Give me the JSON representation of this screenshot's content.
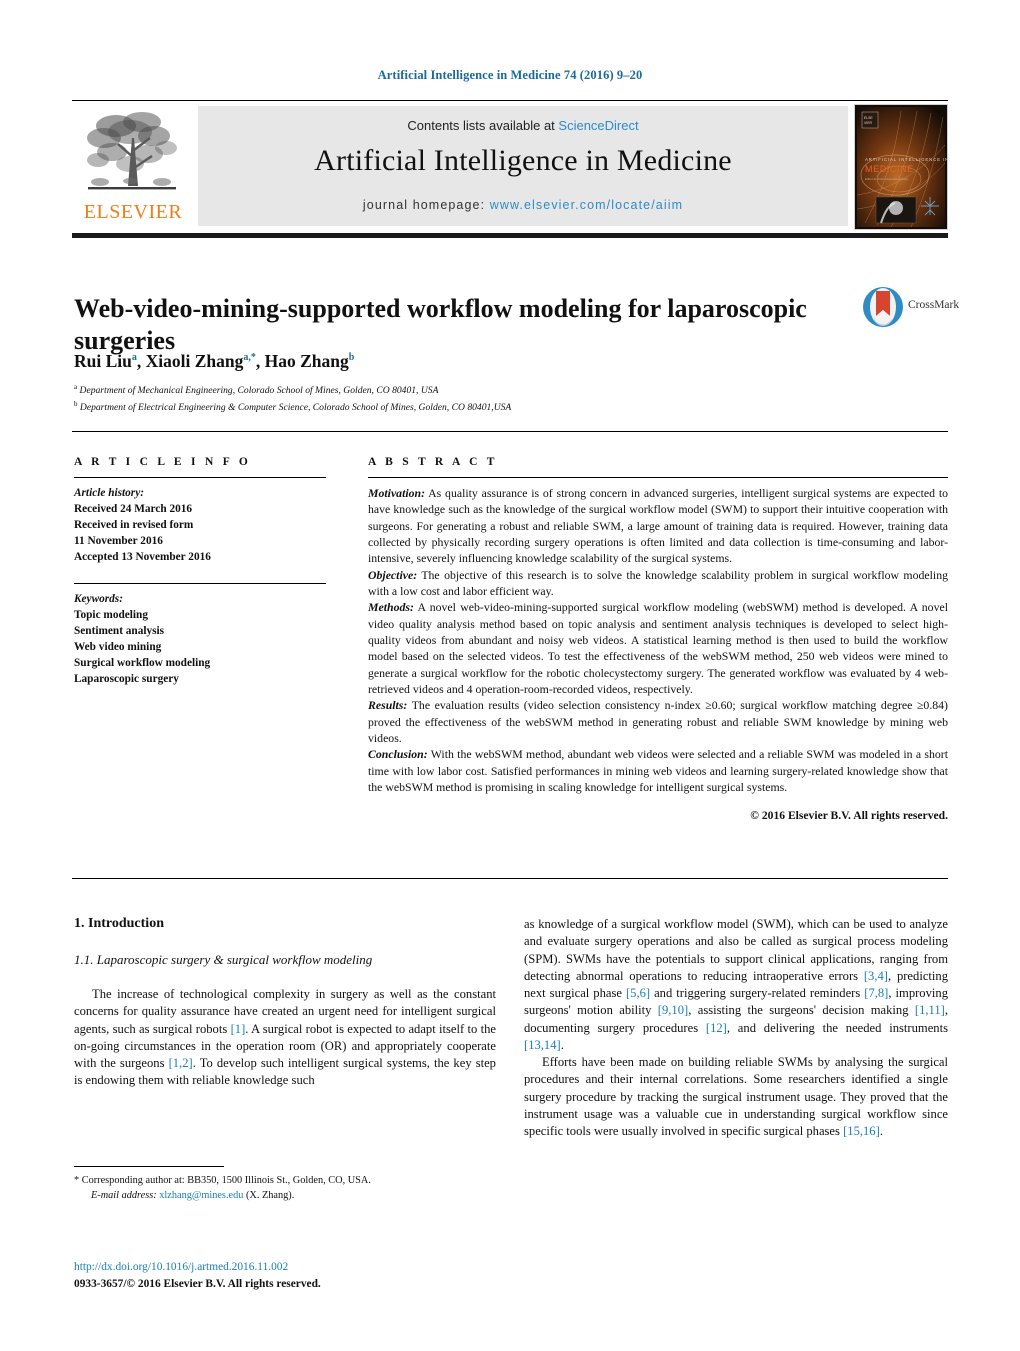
{
  "running_head": "Artificial Intelligence in Medicine 74 (2016) 9–20",
  "masthead": {
    "contents_prefix": "Contents lists available at ",
    "sciencedirect": "ScienceDirect",
    "journal_title": "Artificial Intelligence in Medicine",
    "homepage_prefix": "journal homepage: ",
    "homepage_url": "www.elsevier.com/locate/aiim",
    "publisher_wordmark": "ELSEVIER",
    "publisher_logo_icon": "elsevier-tree-icon",
    "cover_thumbnail_icon": "journal-cover-thumbnail",
    "cover_title_line1": "ARTIFICIAL INTELLIGENCE IN",
    "cover_title_line2": "MEDICINE",
    "link_color": "#2e8bc9"
  },
  "article": {
    "title": "Web-video-mining-supported workflow modeling for laparoscopic surgeries",
    "crossmark_label": "CrossMark",
    "crossmark_icon": "crossmark-badge-icon",
    "authors_html": "Rui Liu<sup>a</sup>, Xiaoli Zhang<sup>a,*</sup>, Hao Zhang<sup>b</sup>",
    "affiliation_a": "Department of Mechanical Engineering, Colorado School of Mines, Golden, CO 80401, USA",
    "affiliation_b": "Department of Electrical Engineering & Computer Science, Colorado School of Mines, Golden, CO 80401,USA"
  },
  "article_info": {
    "heading": "A R T I C L E    I N F O",
    "history_label": "Article history:",
    "history_lines": [
      "Received 24 March 2016",
      "Received in revised form",
      "11 November 2016",
      "Accepted 13 November 2016"
    ],
    "keywords_label": "Keywords:",
    "keywords": [
      "Topic modeling",
      "Sentiment analysis",
      "Web video mining",
      "Surgical workflow modeling",
      "Laparoscopic surgery"
    ]
  },
  "abstract": {
    "heading": "A B S T R A C T",
    "paragraphs": [
      {
        "lead": "Motivation:",
        "text": " As quality assurance is of strong concern in advanced surgeries, intelligent surgical systems are expected to have knowledge such as the knowledge of the surgical workflow model (SWM) to support their intuitive cooperation with surgeons. For generating a robust and reliable SWM, a large amount of training data is required. However, training data collected by physically recording surgery operations is often limited and data collection is time-consuming and labor-intensive, severely influencing knowledge scalability of the surgical systems."
      },
      {
        "lead": "Objective:",
        "text": " The objective of this research is to solve the knowledge scalability problem in surgical workflow modeling with a low cost and labor efficient way."
      },
      {
        "lead": "Methods:",
        "text": " A novel web-video-mining-supported surgical workflow modeling (webSWM) method is developed. A novel video quality analysis method based on topic analysis and sentiment analysis techniques is developed to select high-quality videos from abundant and noisy web videos. A statistical learning method is then used to build the workflow model based on the selected videos. To test the effectiveness of the webSWM method, 250 web videos were mined to generate a surgical workflow for the robotic cholecystectomy surgery. The generated workflow was evaluated by 4 web-retrieved videos and 4 operation-room-recorded videos, respectively."
      },
      {
        "lead": "Results:",
        "text": " The evaluation results (video selection consistency n-index ≥0.60; surgical workflow matching degree ≥0.84) proved the effectiveness of the webSWM method in generating robust and reliable SWM knowledge by mining web videos."
      },
      {
        "lead": "Conclusion:",
        "text": " With the webSWM method, abundant web videos were selected and a reliable SWM was modeled in a short time with low labor cost. Satisfied performances in mining web videos and learning surgery-related knowledge show that the webSWM method is promising in scaling knowledge for intelligent surgical systems."
      }
    ],
    "copyright": "© 2016 Elsevier B.V. All rights reserved."
  },
  "body": {
    "section_heading": "1.  Introduction",
    "subsection_heading": "1.1.  Laparoscopic surgery & surgical workflow modeling",
    "left_paragraph_1": [
      {
        "t": "The increase of technological complexity in surgery as well as the constant concerns for quality assurance have created an urgent need for intelligent surgical agents, such as surgical robots "
      },
      {
        "t": "[1]",
        "ref": true
      },
      {
        "t": ". A surgical robot is expected to adapt itself to the on-going circumstances in the operation room (OR) and appropriately cooperate with the surgeons "
      },
      {
        "t": "[1,2]",
        "ref": true
      },
      {
        "t": ". To develop such intelligent surgical systems, the key step is endowing them with reliable knowledge such"
      }
    ],
    "right_paragraph_1": [
      {
        "t": "as knowledge of a surgical workflow model (SWM), which can be used to analyze and evaluate surgery operations and also be called as surgical process modeling (SPM). SWMs have the potentials to support clinical applications, ranging from detecting abnormal operations to reducing intraoperative errors "
      },
      {
        "t": "[3,4]",
        "ref": true
      },
      {
        "t": ", predicting next surgical phase "
      },
      {
        "t": "[5,6]",
        "ref": true
      },
      {
        "t": " and triggering surgery-related reminders "
      },
      {
        "t": "[7,8]",
        "ref": true
      },
      {
        "t": ", improving surgeons' motion ability "
      },
      {
        "t": "[9,10]",
        "ref": true
      },
      {
        "t": ", assisting the surgeons' decision making "
      },
      {
        "t": "[1,11]",
        "ref": true
      },
      {
        "t": ", documenting surgery procedures "
      },
      {
        "t": "[12]",
        "ref": true
      },
      {
        "t": ", and delivering the needed instruments "
      },
      {
        "t": "[13,14]",
        "ref": true
      },
      {
        "t": "."
      }
    ],
    "right_paragraph_2": [
      {
        "t": "Efforts have been made on building reliable SWMs by analysing the surgical procedures and their internal correlations. Some researchers identified a single surgery procedure by tracking the surgical instrument usage. They proved that the instrument usage was a valuable cue in understanding surgical workflow since specific tools were usually involved in specific surgical phases "
      },
      {
        "t": "[15,16]",
        "ref": true
      },
      {
        "t": "."
      }
    ]
  },
  "footer": {
    "corresponding_note": "* Corresponding author at: BB350, 1500 Illinois St., Golden, CO, USA.",
    "email_label": "E-mail address:",
    "email": "xlzhang@mines.edu",
    "email_suffix": " (X. Zhang).",
    "doi_url": "http://dx.doi.org/10.1016/j.artmed.2016.11.002",
    "issn_line": "0933-3657/© 2016 Elsevier B.V. All rights reserved."
  }
}
